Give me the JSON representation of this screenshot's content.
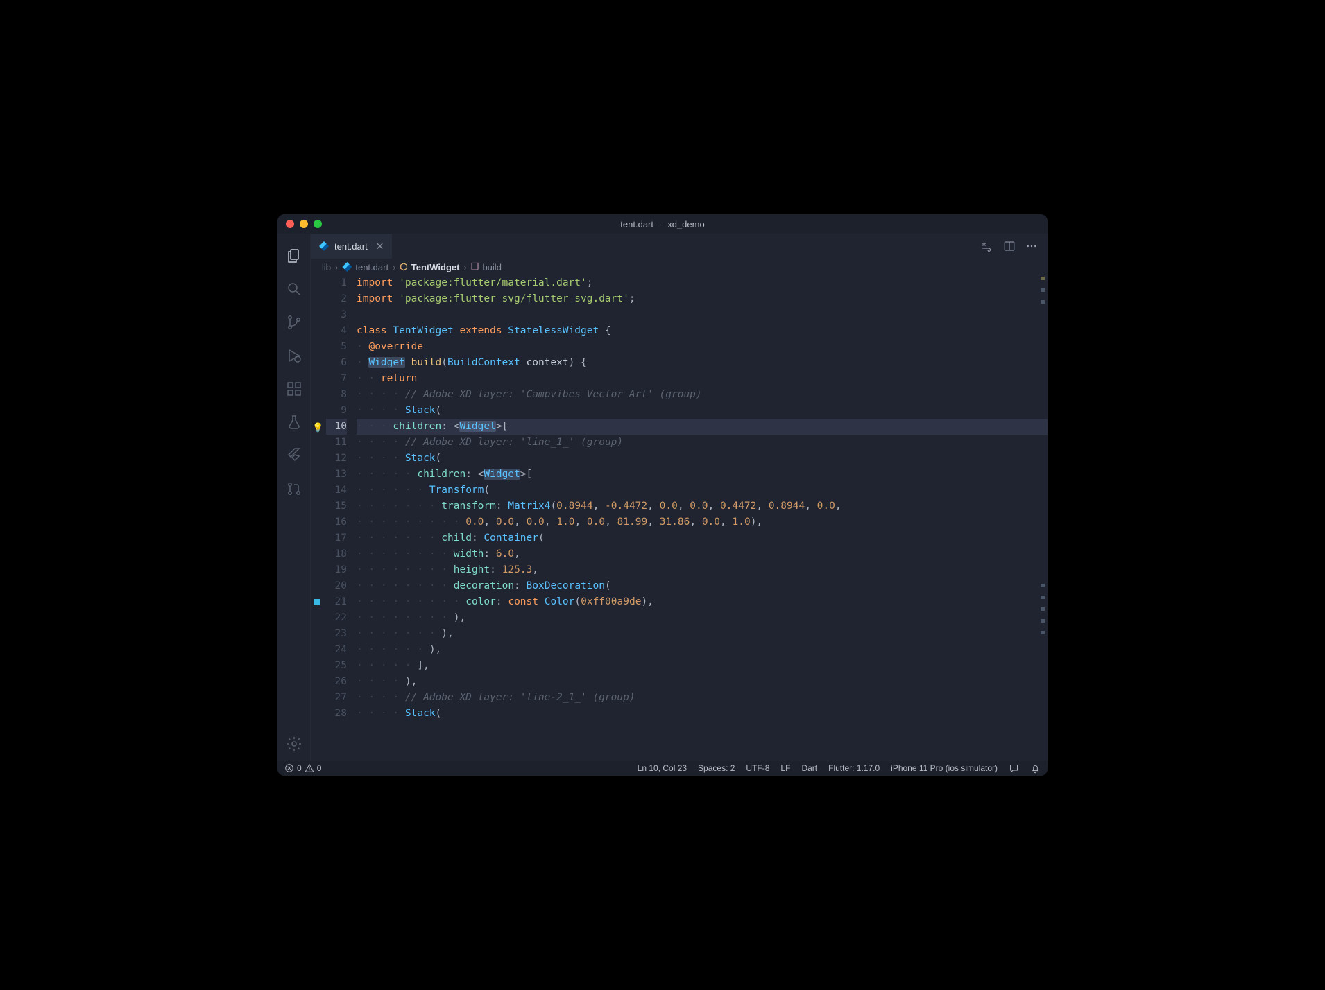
{
  "window": {
    "title": "tent.dart — xd_demo"
  },
  "tabs": [
    {
      "label": "tent.dart",
      "icon": "dart",
      "active": true
    }
  ],
  "tab_actions": {
    "wrap": "word-wrap-icon",
    "split": "split-editor-icon",
    "more": "more-icon"
  },
  "breadcrumbs": {
    "items": [
      {
        "label": "lib",
        "kind": "folder"
      },
      {
        "label": "tent.dart",
        "kind": "file"
      },
      {
        "label": "TentWidget",
        "kind": "class"
      },
      {
        "label": "build",
        "kind": "method"
      }
    ]
  },
  "editor": {
    "current_line": 10,
    "bulb_line": 10,
    "marker_line": 21,
    "lines": [
      {
        "n": 1,
        "tokens": [
          [
            "kw",
            "import"
          ],
          [
            "id",
            " "
          ],
          [
            "str",
            "'package:flutter/material.dart'"
          ],
          [
            "punct",
            ";"
          ]
        ]
      },
      {
        "n": 2,
        "tokens": [
          [
            "kw",
            "import"
          ],
          [
            "id",
            " "
          ],
          [
            "str",
            "'package:flutter_svg/flutter_svg.dart'"
          ],
          [
            "punct",
            ";"
          ]
        ]
      },
      {
        "n": 3,
        "tokens": []
      },
      {
        "n": 4,
        "tokens": [
          [
            "kw",
            "class"
          ],
          [
            "id",
            " "
          ],
          [
            "type",
            "TentWidget"
          ],
          [
            "id",
            " "
          ],
          [
            "kw",
            "extends"
          ],
          [
            "id",
            " "
          ],
          [
            "type",
            "StatelessWidget"
          ],
          [
            "id",
            " "
          ],
          [
            "punct",
            "{"
          ]
        ]
      },
      {
        "n": 5,
        "indent": 1,
        "tokens": [
          [
            "ann",
            "@override"
          ]
        ]
      },
      {
        "n": 6,
        "indent": 1,
        "tokens": [
          [
            "type hi",
            "Widget"
          ],
          [
            "id",
            " "
          ],
          [
            "fn",
            "build"
          ],
          [
            "punct",
            "("
          ],
          [
            "type",
            "BuildContext"
          ],
          [
            "id",
            " context"
          ],
          [
            "punct",
            ")"
          ],
          [
            "id",
            " "
          ],
          [
            "punct",
            "{"
          ]
        ]
      },
      {
        "n": 7,
        "indent": 2,
        "tokens": [
          [
            "kw",
            "return"
          ]
        ]
      },
      {
        "n": 8,
        "indent": 4,
        "tokens": [
          [
            "cmt",
            "// Adobe XD layer: 'Campvibes Vector Art' (group)"
          ]
        ]
      },
      {
        "n": 9,
        "indent": 4,
        "tokens": [
          [
            "type",
            "Stack"
          ],
          [
            "punct",
            "("
          ]
        ]
      },
      {
        "n": 10,
        "indent": 3,
        "tokens": [
          [
            "param",
            "children"
          ],
          [
            "punct",
            ": "
          ],
          [
            "punct",
            "<"
          ],
          [
            "type hi",
            "Widget"
          ],
          [
            "punct",
            ">"
          ],
          [
            "punct",
            "["
          ]
        ]
      },
      {
        "n": 11,
        "indent": 4,
        "tokens": [
          [
            "cmt",
            "// Adobe XD layer: 'line_1_' (group)"
          ]
        ]
      },
      {
        "n": 12,
        "indent": 4,
        "tokens": [
          [
            "type",
            "Stack"
          ],
          [
            "punct",
            "("
          ]
        ]
      },
      {
        "n": 13,
        "indent": 5,
        "tokens": [
          [
            "param",
            "children"
          ],
          [
            "punct",
            ": "
          ],
          [
            "punct",
            "<"
          ],
          [
            "type hi",
            "Widget"
          ],
          [
            "punct",
            ">"
          ],
          [
            "punct",
            "["
          ]
        ]
      },
      {
        "n": 14,
        "indent": 6,
        "tokens": [
          [
            "type",
            "Transform"
          ],
          [
            "punct",
            "("
          ]
        ]
      },
      {
        "n": 15,
        "indent": 7,
        "tokens": [
          [
            "param",
            "transform"
          ],
          [
            "punct",
            ": "
          ],
          [
            "type",
            "Matrix4"
          ],
          [
            "punct",
            "("
          ],
          [
            "num",
            "0.8944"
          ],
          [
            "punct",
            ", "
          ],
          [
            "num",
            "-0.4472"
          ],
          [
            "punct",
            ", "
          ],
          [
            "num",
            "0.0"
          ],
          [
            "punct",
            ", "
          ],
          [
            "num",
            "0.0"
          ],
          [
            "punct",
            ", "
          ],
          [
            "num",
            "0.4472"
          ],
          [
            "punct",
            ", "
          ],
          [
            "num",
            "0.8944"
          ],
          [
            "punct",
            ", "
          ],
          [
            "num",
            "0.0"
          ],
          [
            "punct",
            ","
          ]
        ]
      },
      {
        "n": 16,
        "indent": 9,
        "tokens": [
          [
            "num",
            "0.0"
          ],
          [
            "punct",
            ", "
          ],
          [
            "num",
            "0.0"
          ],
          [
            "punct",
            ", "
          ],
          [
            "num",
            "0.0"
          ],
          [
            "punct",
            ", "
          ],
          [
            "num",
            "1.0"
          ],
          [
            "punct",
            ", "
          ],
          [
            "num",
            "0.0"
          ],
          [
            "punct",
            ", "
          ],
          [
            "num",
            "81.99"
          ],
          [
            "punct",
            ", "
          ],
          [
            "num",
            "31.86"
          ],
          [
            "punct",
            ", "
          ],
          [
            "num",
            "0.0"
          ],
          [
            "punct",
            ", "
          ],
          [
            "num",
            "1.0"
          ],
          [
            "punct",
            "),"
          ]
        ]
      },
      {
        "n": 17,
        "indent": 7,
        "tokens": [
          [
            "param",
            "child"
          ],
          [
            "punct",
            ": "
          ],
          [
            "type",
            "Container"
          ],
          [
            "punct",
            "("
          ]
        ]
      },
      {
        "n": 18,
        "indent": 8,
        "tokens": [
          [
            "param",
            "width"
          ],
          [
            "punct",
            ": "
          ],
          [
            "num",
            "6.0"
          ],
          [
            "punct",
            ","
          ]
        ]
      },
      {
        "n": 19,
        "indent": 8,
        "tokens": [
          [
            "param",
            "height"
          ],
          [
            "punct",
            ": "
          ],
          [
            "num",
            "125.3"
          ],
          [
            "punct",
            ","
          ]
        ]
      },
      {
        "n": 20,
        "indent": 8,
        "tokens": [
          [
            "param",
            "decoration"
          ],
          [
            "punct",
            ": "
          ],
          [
            "type",
            "BoxDecoration"
          ],
          [
            "punct",
            "("
          ]
        ]
      },
      {
        "n": 21,
        "indent": 9,
        "tokens": [
          [
            "param",
            "color"
          ],
          [
            "punct",
            ": "
          ],
          [
            "kw",
            "const"
          ],
          [
            "id",
            " "
          ],
          [
            "type",
            "Color"
          ],
          [
            "punct",
            "("
          ],
          [
            "num",
            "0xff00a9de"
          ],
          [
            "punct",
            "),"
          ]
        ]
      },
      {
        "n": 22,
        "indent": 8,
        "tokens": [
          [
            "punct",
            "),"
          ]
        ]
      },
      {
        "n": 23,
        "indent": 7,
        "tokens": [
          [
            "punct",
            "),"
          ]
        ]
      },
      {
        "n": 24,
        "indent": 6,
        "tokens": [
          [
            "punct",
            "),"
          ]
        ]
      },
      {
        "n": 25,
        "indent": 5,
        "tokens": [
          [
            "punct",
            "],"
          ]
        ]
      },
      {
        "n": 26,
        "indent": 4,
        "tokens": [
          [
            "punct",
            "),"
          ]
        ]
      },
      {
        "n": 27,
        "indent": 4,
        "tokens": [
          [
            "cmt",
            "// Adobe XD layer: 'line-2_1_' (group)"
          ]
        ]
      },
      {
        "n": 28,
        "indent": 4,
        "tokens": [
          [
            "type",
            "Stack"
          ],
          [
            "punct",
            "("
          ]
        ]
      }
    ]
  },
  "statusbar": {
    "errors": "0",
    "warnings": "0",
    "cursor": "Ln 10, Col 23",
    "spaces": "Spaces: 2",
    "encoding": "UTF-8",
    "eol": "LF",
    "language": "Dart",
    "flutter": "Flutter: 1.17.0",
    "device": "iPhone 11 Pro (ios simulator)"
  },
  "activity": {
    "items": [
      "explorer",
      "search",
      "scm",
      "debug",
      "extensions",
      "test",
      "flutter",
      "pull-requests"
    ],
    "bottom": [
      "settings"
    ]
  }
}
